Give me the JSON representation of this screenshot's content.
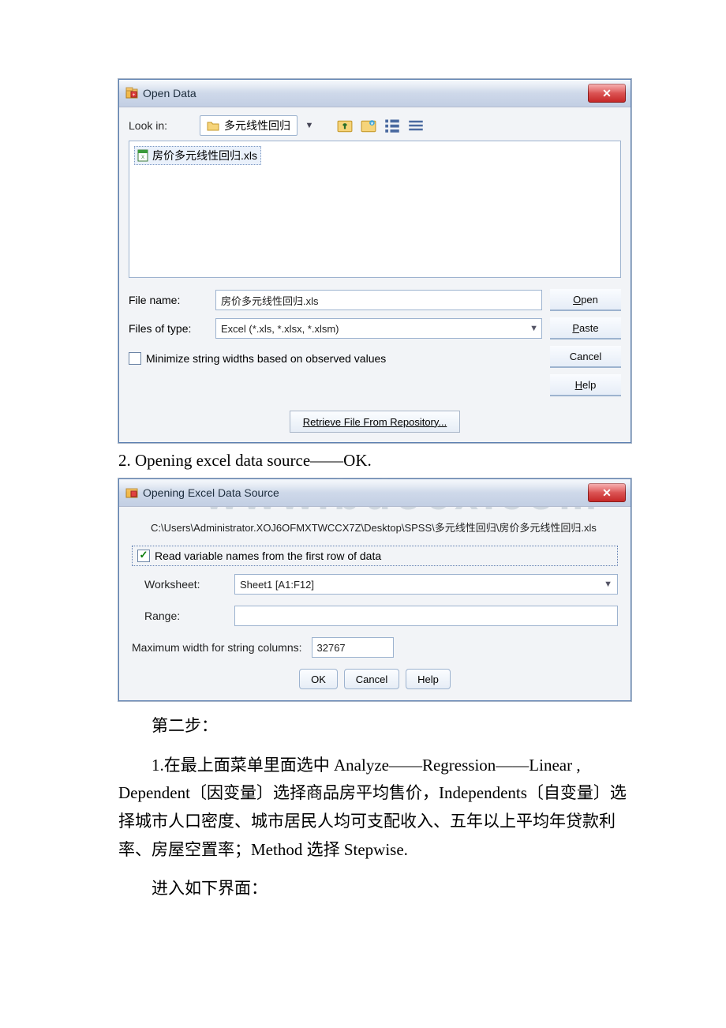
{
  "open_data": {
    "title": "Open Data",
    "look_in_label": "Look in:",
    "look_in_folder": "多元线性回归",
    "toolbar_icons": [
      "folder-up-icon",
      "new-folder-icon",
      "details-view-icon",
      "list-view-icon"
    ],
    "file_in_list": "房价多元线性回归.xls",
    "file_name_label": "File name:",
    "file_name_value": "房价多元线性回归.xls",
    "files_of_type_label": "Files of type:",
    "files_of_type_value": "Excel (*.xls, *.xlsx, *.xlsm)",
    "minimize_checkbox_label": "Minimize string widths based on observed values",
    "retrieve_button": "Retrieve File From Repository...",
    "buttons": {
      "open": "Open",
      "paste": "Paste",
      "cancel": "Cancel",
      "help": "Help"
    },
    "open_underline": "O",
    "paste_underline": "P",
    "help_underline": "H"
  },
  "caption_after_d1": "2. Opening excel data source——OK.",
  "excel_source": {
    "title": "Opening Excel Data Source",
    "path": "C:\\Users\\Administrator.XOJ6OFMXTWCCX7Z\\Desktop\\SPSS\\多元线性回归\\房价多元线性回归.xls",
    "read_var_names_label": "Read variable names from the first row of data",
    "worksheet_label": "Worksheet:",
    "worksheet_value": "Sheet1 [A1:F12]",
    "range_label": "Range:",
    "range_value": "",
    "max_width_label": "Maximum width for string columns:",
    "max_width_value": "32767",
    "buttons": {
      "ok": "OK",
      "cancel": "Cancel",
      "help": "Help"
    }
  },
  "watermark_text": "www.bdocx.com",
  "step2_heading": "第二步：",
  "step2_para": "1.在最上面菜单里面选中 Analyze——Regression——Linear ,  Dependent〔因变量〕选择商品房平均售价，Independents〔自变量〕选择城市人口密度、城市居民人均可支配收入、五年以上平均年贷款利率、房屋空置率；Method 选择 Stepwise.",
  "step2_tail": "进入如下界面："
}
